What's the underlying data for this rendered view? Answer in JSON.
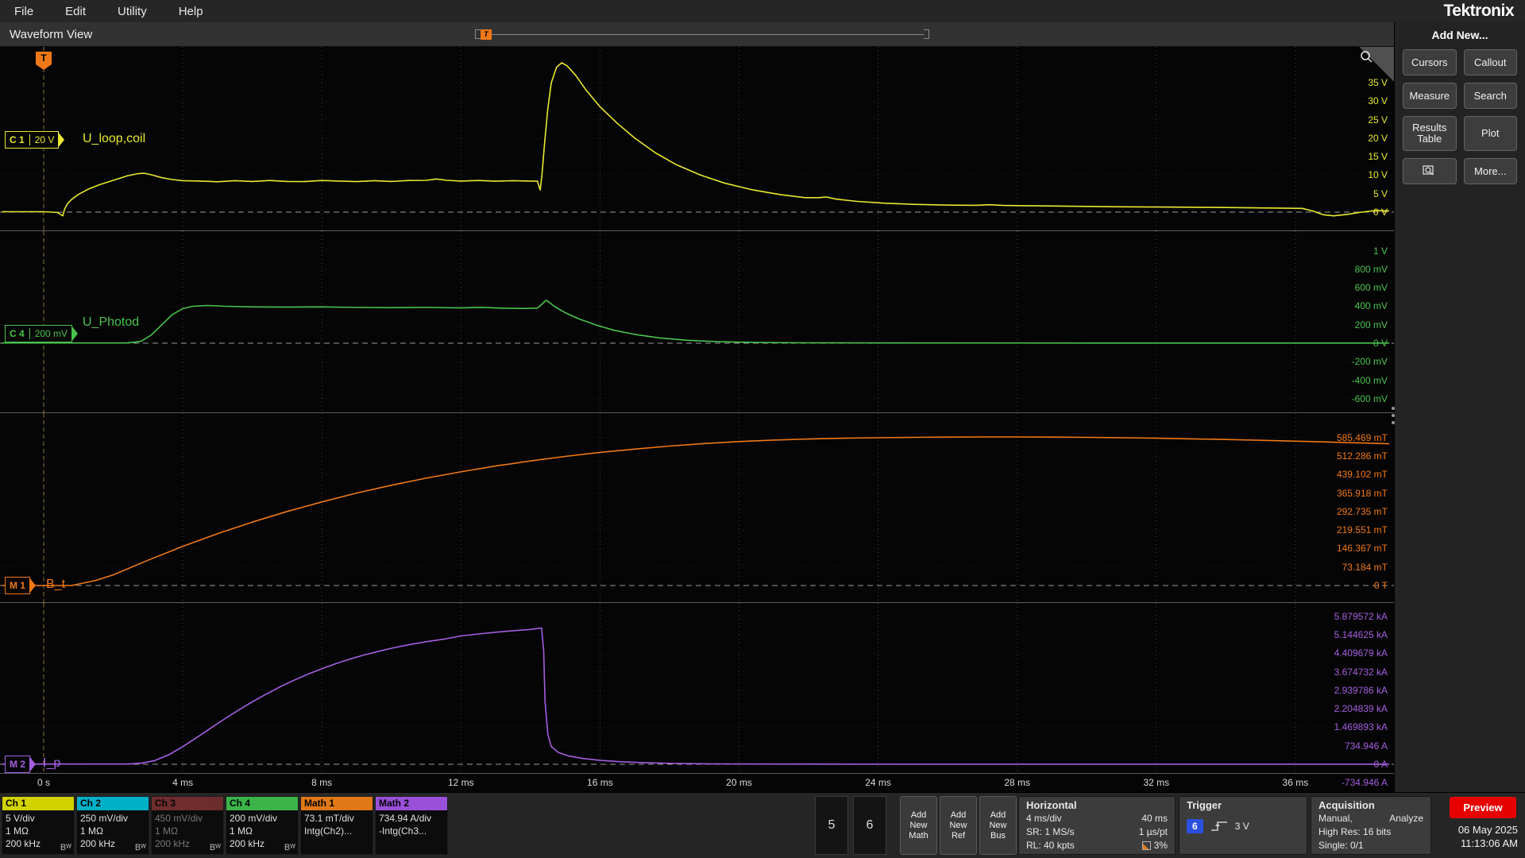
{
  "menu": {
    "items": [
      "File",
      "Edit",
      "Utility",
      "Help"
    ],
    "brand": "Tektronix"
  },
  "view": {
    "title": "Waveform View",
    "trigger_marker": "T"
  },
  "sidebar": {
    "header": "Add New...",
    "buttons": {
      "cursors": "Cursors",
      "callout": "Callout",
      "measure": "Measure",
      "search": "Search",
      "results_table": "Results Table",
      "plot": "Plot",
      "more": "More..."
    }
  },
  "chart_data": {
    "type": "line",
    "x_unit": "ms",
    "x_range_ms": [
      -1.2,
      38.8
    ],
    "x_ticks_ms": [
      0,
      4,
      8,
      12,
      16,
      20,
      24,
      28,
      32,
      36
    ],
    "x_axis_labels": [
      "0 s",
      "4 ms",
      "8 ms",
      "12 ms",
      "16 ms",
      "20 ms",
      "24 ms",
      "28 ms",
      "32 ms",
      "36 ms"
    ],
    "grid": true,
    "panels": [
      {
        "name": "ch1",
        "badge": "C 1",
        "scale": "20 V",
        "label": "U_loop,coil",
        "color": "#e8e830",
        "unit": "V",
        "units_per_div": 5,
        "ticks": [
          {
            "label": "35 V",
            "div": 7
          },
          {
            "label": "30 V",
            "div": 6
          },
          {
            "label": "25 V",
            "div": 5
          },
          {
            "label": "20 V",
            "div": 4
          },
          {
            "label": "15 V",
            "div": 3
          },
          {
            "label": "10 V",
            "div": 2
          },
          {
            "label": "5 V",
            "div": 1
          },
          {
            "label": "0 V",
            "div": 0
          }
        ],
        "series": [
          [
            -1.2,
            0.1
          ],
          [
            0,
            0.1
          ],
          [
            0.4,
            -0.1
          ],
          [
            0.55,
            -1.0
          ],
          [
            0.6,
            0.8
          ],
          [
            0.68,
            2.2
          ],
          [
            0.8,
            3.4
          ],
          [
            1.0,
            4.8
          ],
          [
            1.3,
            6.3
          ],
          [
            1.6,
            7.4
          ],
          [
            2.0,
            8.6
          ],
          [
            2.4,
            9.8
          ],
          [
            2.7,
            10.4
          ],
          [
            2.9,
            10.5
          ],
          [
            3.1,
            10.1
          ],
          [
            3.4,
            9.3
          ],
          [
            3.7,
            8.8
          ],
          [
            4.0,
            8.5
          ],
          [
            4.5,
            8.4
          ],
          [
            5.0,
            8.2
          ],
          [
            5.5,
            8.5
          ],
          [
            6.0,
            8.3
          ],
          [
            6.5,
            8.55
          ],
          [
            7.0,
            8.3
          ],
          [
            7.5,
            8.25
          ],
          [
            8.0,
            8.55
          ],
          [
            8.5,
            8.4
          ],
          [
            9.0,
            8.25
          ],
          [
            9.5,
            8.5
          ],
          [
            10.0,
            8.3
          ],
          [
            10.5,
            8.55
          ],
          [
            11.0,
            8.6
          ],
          [
            11.3,
            8.95
          ],
          [
            11.6,
            8.6
          ],
          [
            12.0,
            8.4
          ],
          [
            12.5,
            8.55
          ],
          [
            13.0,
            8.35
          ],
          [
            13.5,
            8.5
          ],
          [
            14.0,
            8.4
          ],
          [
            14.2,
            8.35
          ],
          [
            14.28,
            6.0
          ],
          [
            14.33,
            10.0
          ],
          [
            14.4,
            18
          ],
          [
            14.5,
            28
          ],
          [
            14.6,
            35
          ],
          [
            14.75,
            39.2
          ],
          [
            14.9,
            40.4
          ],
          [
            15.05,
            39.6
          ],
          [
            15.3,
            37
          ],
          [
            15.6,
            33
          ],
          [
            16.0,
            28.5
          ],
          [
            16.5,
            24
          ],
          [
            17.0,
            20
          ],
          [
            17.6,
            16
          ],
          [
            18.2,
            12.8
          ],
          [
            18.9,
            10
          ],
          [
            19.6,
            7.8
          ],
          [
            20.4,
            6.0
          ],
          [
            21.2,
            4.7
          ],
          [
            21.9,
            3.9
          ],
          [
            22.3,
            3.9
          ],
          [
            22.5,
            4.1
          ],
          [
            22.8,
            3.5
          ],
          [
            23.4,
            2.9
          ],
          [
            24.2,
            2.4
          ],
          [
            25.0,
            2.1
          ],
          [
            26.0,
            1.9
          ],
          [
            26.8,
            1.85
          ],
          [
            27.2,
            2.0
          ],
          [
            27.6,
            1.8
          ],
          [
            28.5,
            1.7
          ],
          [
            29.5,
            1.6
          ],
          [
            31.0,
            1.45
          ],
          [
            32.5,
            1.35
          ],
          [
            34.0,
            1.25
          ],
          [
            35.5,
            1.1
          ],
          [
            36.2,
            1.0
          ],
          [
            36.5,
            0.3
          ],
          [
            36.8,
            -0.7
          ],
          [
            37.1,
            -1.0
          ],
          [
            37.5,
            -0.6
          ],
          [
            37.9,
            0.0
          ],
          [
            38.3,
            0.4
          ],
          [
            38.7,
            0.35
          ]
        ]
      },
      {
        "name": "ch4",
        "badge": "C 4",
        "scale": "200 mV",
        "label": "U_Photod",
        "color": "#49c24d",
        "unit": "mV",
        "units_per_div": 200,
        "ticks": [
          {
            "label": "1 V",
            "div": 5
          },
          {
            "label": "800 mV",
            "div": 4
          },
          {
            "label": "600 mV",
            "div": 3
          },
          {
            "label": "400 mV",
            "div": 2
          },
          {
            "label": "200 mV",
            "div": 1
          },
          {
            "label": "0 V",
            "div": 0
          },
          {
            "label": "-200 mV",
            "div": -1
          },
          {
            "label": "-400 mV",
            "div": -2
          },
          {
            "label": "-600 mV",
            "div": -3
          }
        ],
        "series": [
          [
            -1.2,
            3
          ],
          [
            2.4,
            3
          ],
          [
            2.8,
            20
          ],
          [
            3.1,
            90
          ],
          [
            3.4,
            200
          ],
          [
            3.7,
            310
          ],
          [
            4.0,
            375
          ],
          [
            4.3,
            400
          ],
          [
            4.7,
            408
          ],
          [
            5.2,
            400
          ],
          [
            6.0,
            393
          ],
          [
            7.0,
            390
          ],
          [
            8.0,
            393
          ],
          [
            9.0,
            387
          ],
          [
            10.0,
            384
          ],
          [
            11.0,
            387
          ],
          [
            12.0,
            382
          ],
          [
            12.6,
            388
          ],
          [
            13.2,
            379
          ],
          [
            13.8,
            376
          ],
          [
            14.2,
            380
          ],
          [
            14.35,
            430
          ],
          [
            14.45,
            465
          ],
          [
            14.55,
            440
          ],
          [
            14.7,
            395
          ],
          [
            15.0,
            330
          ],
          [
            15.4,
            262
          ],
          [
            15.9,
            195
          ],
          [
            16.4,
            140
          ],
          [
            17.0,
            95
          ],
          [
            17.7,
            58
          ],
          [
            18.5,
            32
          ],
          [
            19.4,
            16
          ],
          [
            20.5,
            8
          ],
          [
            22,
            4
          ],
          [
            25,
            3
          ],
          [
            30,
            2
          ],
          [
            35,
            2
          ],
          [
            38.7,
            2
          ]
        ]
      },
      {
        "name": "math1",
        "badge": "M 1",
        "scale": "",
        "label": "B_t",
        "color": "#f07818",
        "unit": "mT",
        "units_per_div": 73.184,
        "ticks": [
          {
            "label": "585.469 mT",
            "div": 8
          },
          {
            "label": "512.286 mT",
            "div": 7
          },
          {
            "label": "439.102 mT",
            "div": 6
          },
          {
            "label": "365.918 mT",
            "div": 5
          },
          {
            "label": "292.735 mT",
            "div": 4
          },
          {
            "label": "219.551 mT",
            "div": 3
          },
          {
            "label": "146.367 mT",
            "div": 2
          },
          {
            "label": "73.184 mT",
            "div": 1
          },
          {
            "label": "0 T",
            "div": 0
          }
        ],
        "series": [
          [
            -1.2,
            0
          ],
          [
            0.8,
            0
          ],
          [
            1.5,
            20
          ],
          [
            2,
            42
          ],
          [
            3,
            100
          ],
          [
            4,
            155
          ],
          [
            5,
            205
          ],
          [
            6,
            251
          ],
          [
            7,
            293
          ],
          [
            8,
            331
          ],
          [
            9,
            366
          ],
          [
            10,
            397
          ],
          [
            11,
            425
          ],
          [
            12,
            450
          ],
          [
            13,
            473
          ],
          [
            14,
            493
          ],
          [
            15,
            511
          ],
          [
            16,
            527
          ],
          [
            17,
            540
          ],
          [
            18,
            552
          ],
          [
            19,
            562
          ],
          [
            20,
            570
          ],
          [
            21,
            576
          ],
          [
            22,
            580
          ],
          [
            23,
            583
          ],
          [
            24,
            585
          ],
          [
            25,
            586.5
          ],
          [
            26,
            587.5
          ],
          [
            27,
            588
          ],
          [
            28,
            588
          ],
          [
            29,
            587.5
          ],
          [
            30,
            586.5
          ],
          [
            31,
            585
          ],
          [
            32,
            583
          ],
          [
            33,
            580.5
          ],
          [
            34,
            578
          ],
          [
            35,
            575
          ],
          [
            36,
            571.5
          ],
          [
            37,
            568
          ],
          [
            38,
            564
          ],
          [
            38.7,
            561
          ]
        ]
      },
      {
        "name": "math2",
        "badge": "M 2",
        "scale": "",
        "label": "I_p",
        "color": "#a55ee0",
        "unit": "A",
        "units_per_div": 734.946,
        "ticks": [
          {
            "label": "5.879572 kA",
            "div": 8
          },
          {
            "label": "5.144625 kA",
            "div": 7
          },
          {
            "label": "4.409679 kA",
            "div": 6
          },
          {
            "label": "3.674732 kA",
            "div": 5
          },
          {
            "label": "2.939786 kA",
            "div": 4
          },
          {
            "label": "2.204839 kA",
            "div": 3
          },
          {
            "label": "1.469893 kA",
            "div": 2
          },
          {
            "label": "734.946 A",
            "div": 1
          },
          {
            "label": "0 A",
            "div": 0
          },
          {
            "label": "-734.946 A",
            "div": -1
          }
        ],
        "series": [
          [
            -1.2,
            5
          ],
          [
            2.4,
            8
          ],
          [
            2.8,
            40
          ],
          [
            3.2,
            150
          ],
          [
            3.6,
            380
          ],
          [
            4.0,
            700
          ],
          [
            4.4,
            1060
          ],
          [
            4.8,
            1430
          ],
          [
            5.2,
            1800
          ],
          [
            5.6,
            2150
          ],
          [
            6.0,
            2480
          ],
          [
            6.4,
            2790
          ],
          [
            6.8,
            3080
          ],
          [
            7.2,
            3340
          ],
          [
            7.6,
            3580
          ],
          [
            8.0,
            3800
          ],
          [
            8.4,
            4000
          ],
          [
            8.8,
            4180
          ],
          [
            9.2,
            4340
          ],
          [
            9.6,
            4480
          ],
          [
            10.0,
            4610
          ],
          [
            10.5,
            4750
          ],
          [
            11.0,
            4870
          ],
          [
            11.5,
            4970
          ],
          [
            12.0,
            5100
          ],
          [
            12.5,
            5180
          ],
          [
            13.0,
            5250
          ],
          [
            13.5,
            5310
          ],
          [
            14.0,
            5360
          ],
          [
            14.2,
            5395
          ],
          [
            14.32,
            5420
          ],
          [
            14.38,
            4500
          ],
          [
            14.42,
            2500
          ],
          [
            14.5,
            1200
          ],
          [
            14.6,
            700
          ],
          [
            14.8,
            470
          ],
          [
            15.1,
            330
          ],
          [
            15.5,
            230
          ],
          [
            16.0,
            155
          ],
          [
            16.6,
            100
          ],
          [
            17.3,
            60
          ],
          [
            18.2,
            32
          ],
          [
            19.2,
            16
          ],
          [
            20.5,
            8
          ],
          [
            22,
            5
          ],
          [
            25,
            4
          ],
          [
            30,
            3
          ],
          [
            35,
            3
          ],
          [
            38.7,
            3
          ]
        ]
      }
    ]
  },
  "bottom": {
    "channels": [
      {
        "name": "Ch 1",
        "color": "#d2d200",
        "lines": [
          "5 V/div",
          "1 MΩ",
          "200 kHz"
        ],
        "bw": "Bᵂ"
      },
      {
        "name": "Ch 2",
        "color": "#00b0c8",
        "lines": [
          "250 mV/div",
          "1 MΩ",
          "200 kHz"
        ],
        "bw": "Bᵂ"
      },
      {
        "name": "Ch 3",
        "color": "#c04848",
        "lines": [
          "450 mV/div",
          "1 MΩ",
          "200 kHz"
        ],
        "bw": "Bᵂ",
        "dimmed": true
      },
      {
        "name": "Ch 4",
        "color": "#3cb44a",
        "lines": [
          "200 mV/div",
          "1 MΩ",
          "200 kHz"
        ],
        "bw": "Bᵂ"
      },
      {
        "name": "Math 1",
        "color": "#e07818",
        "lines": [
          "73.1 mT/div",
          "Intg(Ch2)..."
        ]
      },
      {
        "name": "Math 2",
        "color": "#9a50d8",
        "lines": [
          "734.94 A/div",
          "-Intg(Ch3..."
        ]
      }
    ],
    "inactive_channels": [
      "5",
      "6"
    ],
    "add_buttons": [
      {
        "id": "math",
        "lines": [
          "Add",
          "New",
          "Math"
        ]
      },
      {
        "id": "ref",
        "lines": [
          "Add",
          "New",
          "Ref"
        ]
      },
      {
        "id": "bus",
        "lines": [
          "Add",
          "New",
          "Bus"
        ]
      }
    ],
    "horizontal": {
      "title": "Horizontal",
      "rows": [
        [
          "4 ms/div",
          "40 ms"
        ],
        [
          "SR: 1 MS/s",
          "1 µs/pt"
        ],
        [
          "RL: 40 kpts",
          "3%"
        ]
      ]
    },
    "trigger": {
      "title": "Trigger",
      "source_badge": "6",
      "level": "3 V",
      "badge_color": "#2b50e0"
    },
    "acquisition": {
      "title": "Acquisition",
      "row1_left": "Manual,",
      "row1_right": "Analyze",
      "row2": "High Res: 16 bits",
      "row3": "Single: 0/1"
    },
    "preview": "Preview",
    "date": "06 May 2025",
    "time": "11:13:06 AM"
  }
}
